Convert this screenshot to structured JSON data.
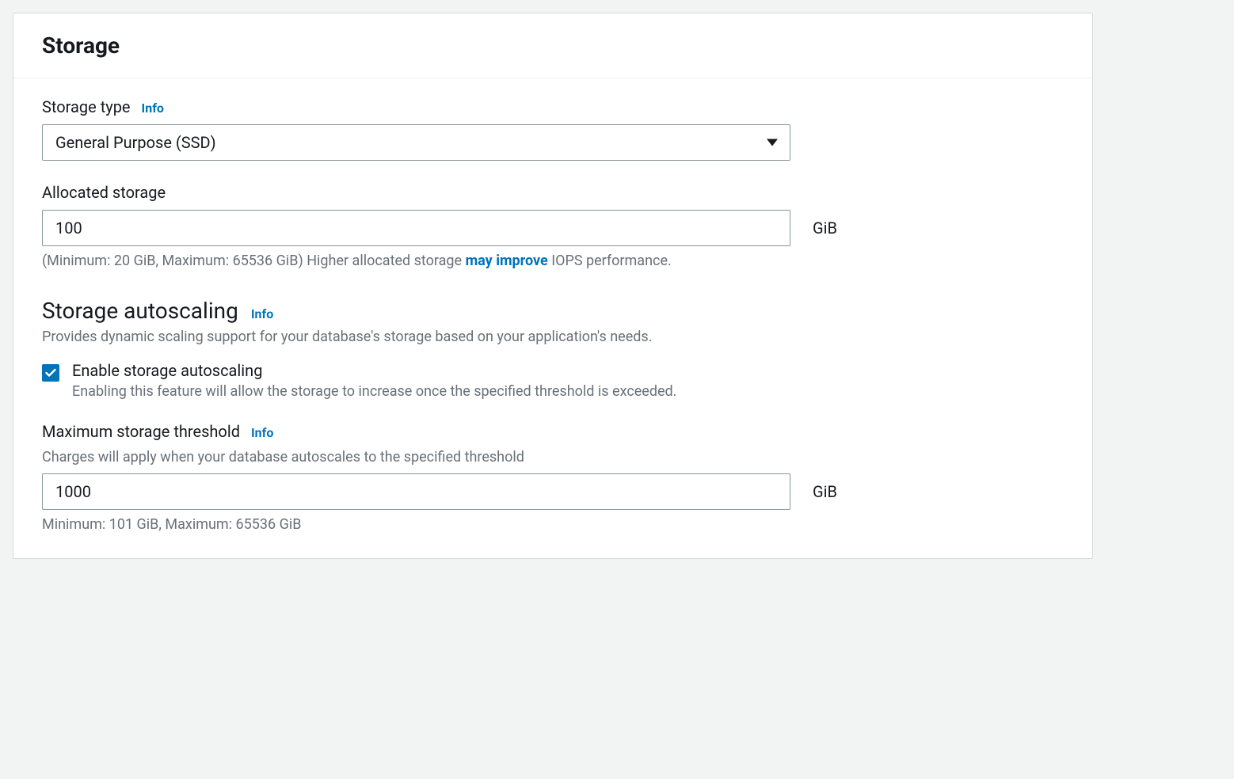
{
  "panel": {
    "title": "Storage"
  },
  "storage_type": {
    "label": "Storage type",
    "info": "Info",
    "selected": "General Purpose (SSD)"
  },
  "allocated_storage": {
    "label": "Allocated storage",
    "value": "100",
    "unit": "GiB",
    "hint_prefix": "(Minimum: 20 GiB, Maximum: 65536 GiB) Higher allocated storage ",
    "hint_emph": "may improve",
    "hint_suffix": " IOPS performance."
  },
  "autoscaling": {
    "heading": "Storage autoscaling",
    "info": "Info",
    "desc": "Provides dynamic scaling support for your database's storage based on your application's needs.",
    "checkbox_label": "Enable storage autoscaling",
    "checkbox_desc": "Enabling this feature will allow the storage to increase once the specified threshold is exceeded."
  },
  "max_threshold": {
    "label": "Maximum storage threshold",
    "info": "Info",
    "desc": "Charges will apply when your database autoscales to the specified threshold",
    "value": "1000",
    "unit": "GiB",
    "hint": "Minimum: 101 GiB, Maximum: 65536 GiB"
  }
}
